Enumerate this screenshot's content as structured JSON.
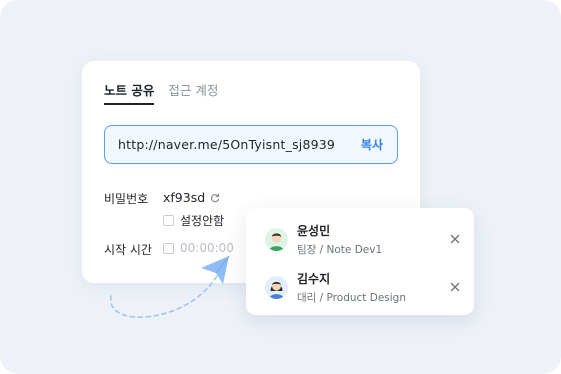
{
  "tabs": [
    {
      "label": "노트 공유",
      "active": true
    },
    {
      "label": "접근 계정",
      "active": false
    }
  ],
  "share": {
    "url": "http://naver.me/5OnTyisnt_sj8939",
    "copy_label": "복사",
    "password_label": "비밀번호",
    "password_value": "xf93sd",
    "no_setting_label": "설정안함",
    "start_time_label": "시작 시간",
    "start_time_value": "00:00:00"
  },
  "members": [
    {
      "name": "윤성민",
      "role": "팀장 / Note Dev1"
    },
    {
      "name": "김수지",
      "role": "대리 / Product Design"
    }
  ],
  "colors": {
    "accent": "#2f80ed",
    "url_border": "#5b9df0",
    "backdrop": "#eef2f8"
  },
  "icons": [
    "refresh-icon",
    "close-icon",
    "arrow-icon"
  ]
}
